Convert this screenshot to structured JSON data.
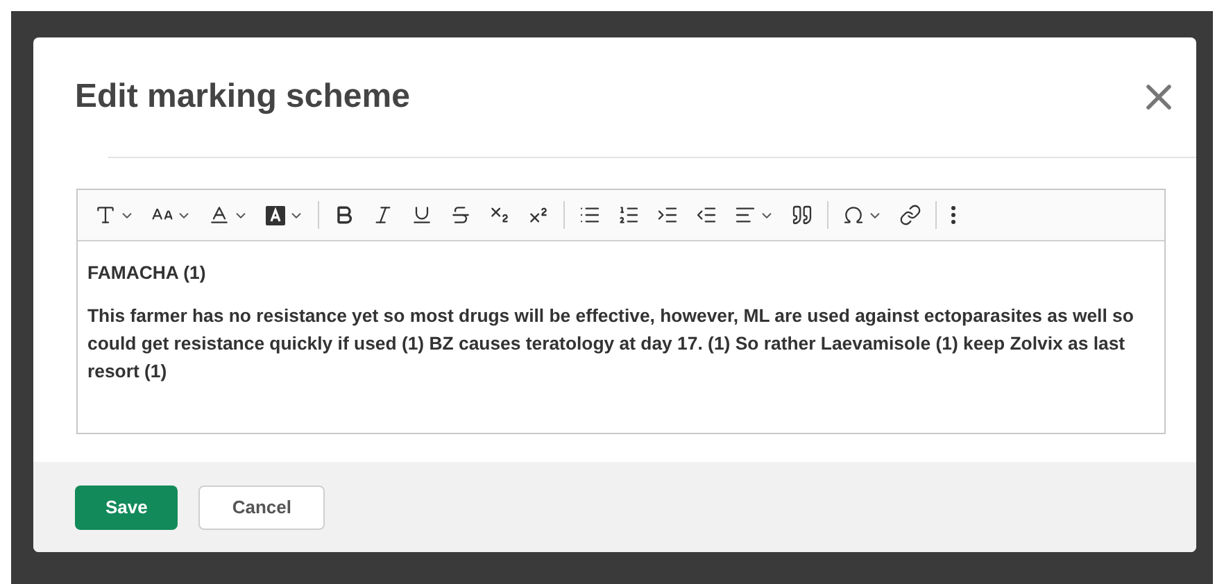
{
  "dialog": {
    "title": "Edit marking scheme",
    "toolbar": [
      {
        "kind": "font-family",
        "dropdown": true
      },
      {
        "kind": "font-size",
        "dropdown": true
      },
      {
        "kind": "font-color",
        "dropdown": true
      },
      {
        "kind": "background-color",
        "dropdown": true
      },
      {
        "kind": "divider"
      },
      {
        "kind": "bold",
        "dropdown": false
      },
      {
        "kind": "italic",
        "dropdown": false
      },
      {
        "kind": "underline",
        "dropdown": false
      },
      {
        "kind": "strikethrough",
        "dropdown": false
      },
      {
        "kind": "subscript",
        "dropdown": false
      },
      {
        "kind": "superscript",
        "dropdown": false
      },
      {
        "kind": "divider"
      },
      {
        "kind": "bulleted-list",
        "dropdown": false
      },
      {
        "kind": "numbered-list",
        "dropdown": false
      },
      {
        "kind": "indent",
        "dropdown": false
      },
      {
        "kind": "outdent",
        "dropdown": false
      },
      {
        "kind": "align",
        "dropdown": true
      },
      {
        "kind": "quote",
        "dropdown": false
      },
      {
        "kind": "divider"
      },
      {
        "kind": "special-characters",
        "dropdown": true
      },
      {
        "kind": "link",
        "dropdown": false
      },
      {
        "kind": "divider"
      },
      {
        "kind": "more",
        "dropdown": false
      }
    ],
    "paragraphs": [
      "FAMACHA (1)",
      "This farmer has no resistance yet so most drugs will be effective, however, ML are used against ectoparasites as well so could get resistance quickly if used (1) BZ causes teratology at day 17. (1) So rather Laevamisole (1) keep Zolvix as last resort (1)"
    ],
    "buttons": [
      {
        "label": "Save",
        "kind": "primary"
      },
      {
        "label": "Cancel",
        "kind": "secondary"
      }
    ]
  }
}
